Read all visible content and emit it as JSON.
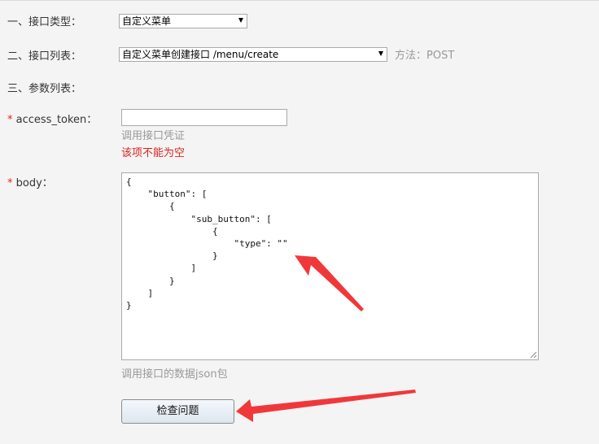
{
  "form": {
    "interface_type": {
      "label": "一、接口类型：",
      "selected": "自定义菜单"
    },
    "interface_list": {
      "label": "二、接口列表：",
      "selected": "自定义菜单创建接口 /menu/create",
      "method": "方法：POST"
    },
    "params_heading": "三、参数列表：",
    "access_token": {
      "required_mark": "*",
      "label": " access_token：",
      "value": "",
      "hint": "调用接口凭证",
      "error": "该项不能为空"
    },
    "body": {
      "required_mark": "*",
      "label": " body：",
      "value": "{\n    \"button\": [\n        {\n            \"sub_button\": [\n                {\n                    \"type\": \"\"\n                }\n            ]\n        }\n    ]\n}",
      "hint": "调用接口的数据json包"
    },
    "check_button": "检查问题"
  },
  "colors": {
    "error": "#d9251d",
    "annotation_arrow": "#f0383a",
    "hint": "#999999"
  }
}
